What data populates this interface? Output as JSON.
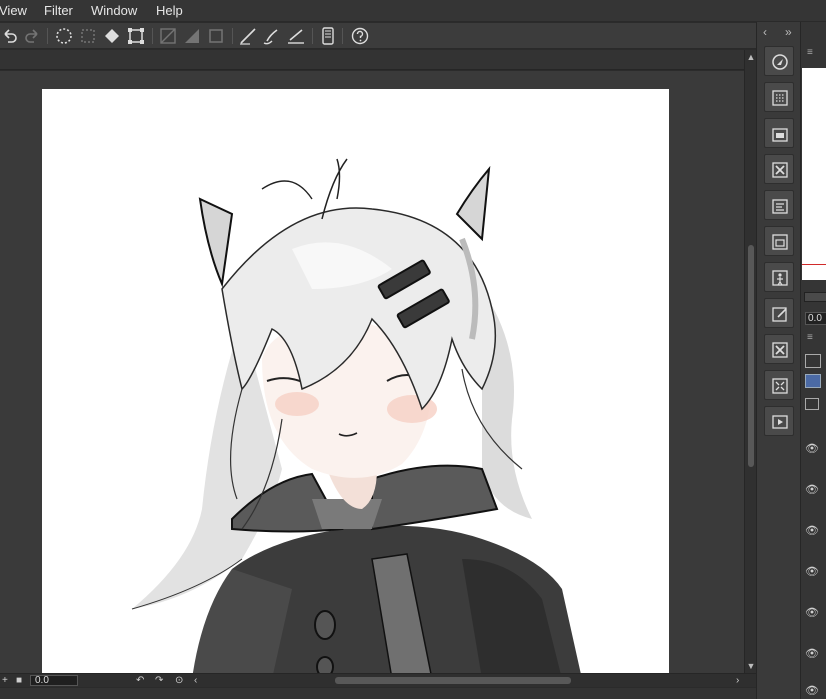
{
  "menu": {
    "view": "View",
    "filter": "Filter",
    "window": "Window",
    "help": "Help"
  },
  "status": {
    "zoom_value": "0.0"
  },
  "right_panel": {
    "value": "0.0"
  },
  "toolbar_icons": [
    "undo-icon",
    "redo-icon",
    "selection-icon",
    "marquee-icon",
    "fill-icon",
    "transform-icon",
    "snap-ruler-icon",
    "snap-grid-icon",
    "snap-special-icon",
    "pen-correction-icon",
    "brush-icon",
    "line-icon",
    "tablet-icon",
    "help-icon"
  ],
  "command_icons": [
    "navigator-icon",
    "material-icon",
    "layer-property-icon",
    "close-icon",
    "layer-search-icon",
    "layer-icon",
    "tool-property-icon",
    "edit-icon",
    "close-icon",
    "transform-icon",
    "animation-icon"
  ],
  "colors": {
    "bg": "#2b2b2b",
    "canvas": "#3a3a3a",
    "paper": "#ffffff",
    "accent": "#d12a2a"
  }
}
